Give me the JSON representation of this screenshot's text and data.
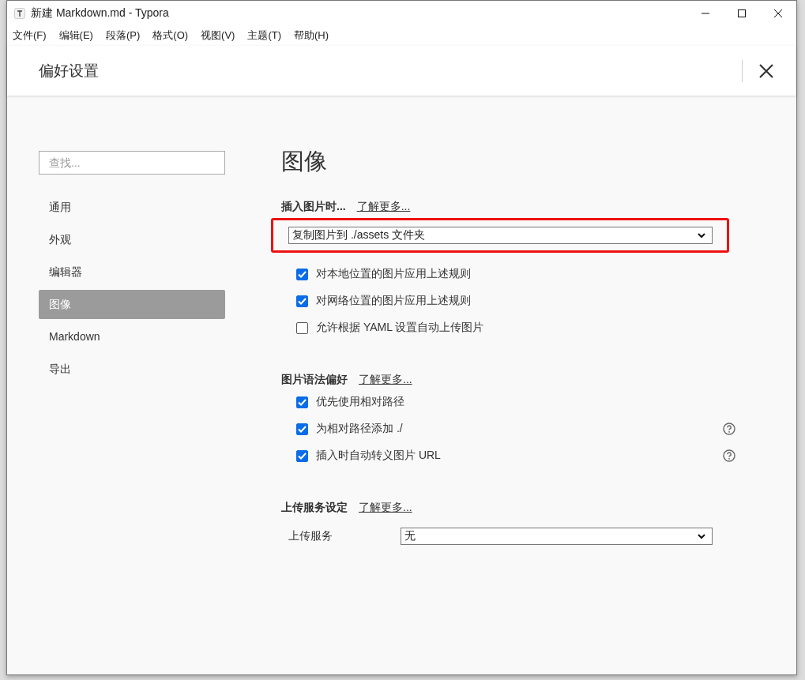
{
  "window": {
    "title": "新建 Markdown.md - Typora"
  },
  "menu": [
    "文件(F)",
    "编辑(E)",
    "段落(P)",
    "格式(O)",
    "视图(V)",
    "主题(T)",
    "帮助(H)"
  ],
  "dialog": {
    "title": "偏好设置"
  },
  "sidebar": {
    "search": {
      "placeholder": "查找..."
    },
    "items": [
      {
        "label": "通用",
        "selected": false
      },
      {
        "label": "外观",
        "selected": false
      },
      {
        "label": "编辑器",
        "selected": false
      },
      {
        "label": "图像",
        "selected": true
      },
      {
        "label": "Markdown",
        "selected": false
      },
      {
        "label": "导出",
        "selected": false
      }
    ]
  },
  "page": {
    "title": "图像",
    "sections": [
      {
        "title": "插入图片时...",
        "link": "了解更多...",
        "rows": [
          {
            "kind": "select",
            "value": "复制图片到 ./assets 文件夹",
            "highlighted": true
          },
          {
            "kind": "checkbox",
            "label": "对本地位置的图片应用上述规则",
            "checked": true,
            "help": false
          },
          {
            "kind": "checkbox",
            "label": "对网络位置的图片应用上述规则",
            "checked": true,
            "help": false
          },
          {
            "kind": "checkbox",
            "label": "允许根据 YAML 设置自动上传图片",
            "checked": false,
            "help": false
          }
        ]
      },
      {
        "title": "图片语法偏好",
        "link": "了解更多...",
        "rows": [
          {
            "kind": "checkbox",
            "label": "优先使用相对路径",
            "checked": true,
            "help": false
          },
          {
            "kind": "checkbox",
            "label": "为相对路径添加 ./",
            "checked": true,
            "help": true
          },
          {
            "kind": "checkbox",
            "label": "插入时自动转义图片 URL",
            "checked": true,
            "help": true
          }
        ]
      },
      {
        "title": "上传服务设定",
        "link": "了解更多...",
        "rows": [
          {
            "kind": "select",
            "label": "上传服务",
            "value": "无",
            "highlighted": false
          }
        ]
      }
    ]
  }
}
